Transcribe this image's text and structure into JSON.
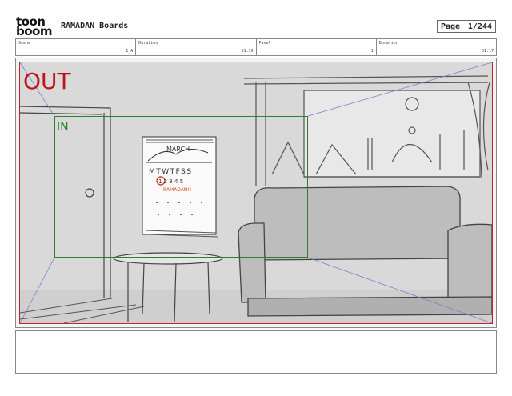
{
  "header": {
    "logo_top": "toon",
    "logo_bottom": "boom",
    "title": "RAMADAN Boards",
    "page_label": "Page",
    "page_value": "1/244"
  },
  "info": [
    {
      "label": "Scene",
      "value": "1_A"
    },
    {
      "label": "Duration",
      "value": "01:19"
    },
    {
      "label": "Panel",
      "value": "1"
    },
    {
      "label": "Duration",
      "value": "01:17"
    }
  ],
  "frame": {
    "out_label": "OUT",
    "in_label": "IN"
  },
  "calendar": {
    "month": "MARCH",
    "days": "MTWTFSS",
    "dates": "1 2 3 4 5",
    "note": "RAMADAN!!"
  },
  "colors": {
    "out_frame": "#c8202a",
    "in_frame": "#2e7d32",
    "annotation": "#d8431f"
  },
  "notes": ""
}
